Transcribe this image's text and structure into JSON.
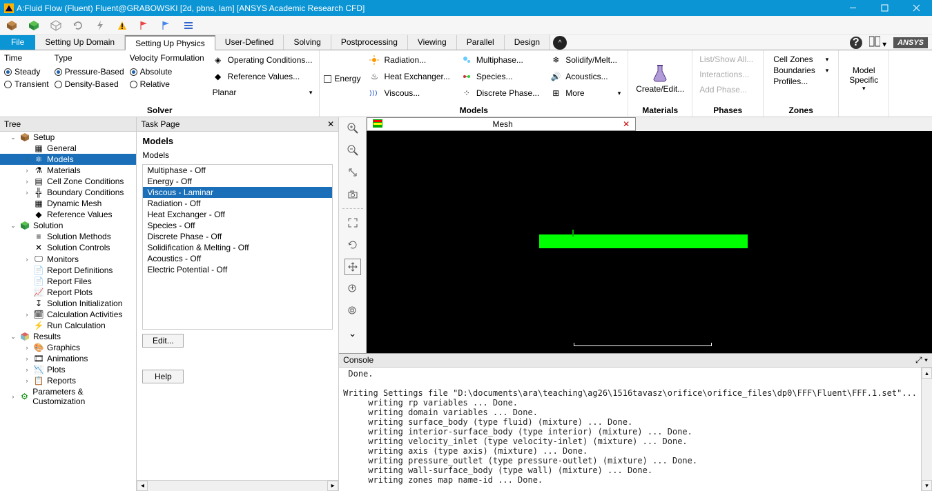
{
  "titlebar": {
    "title": "A:Fluid Flow (Fluent) Fluent@GRABOWSKI  [2d, pbns, lam]  [ANSYS Academic Research CFD]"
  },
  "tabs": {
    "file": "File",
    "domain": "Setting Up Domain",
    "physics": "Setting Up Physics",
    "user": "User-Defined",
    "solving": "Solving",
    "post": "Postprocessing",
    "viewing": "Viewing",
    "parallel": "Parallel",
    "design": "Design"
  },
  "ribbon": {
    "solver": {
      "label": "Solver",
      "time": "Time",
      "steady": "Steady",
      "transient": "Transient",
      "type": "Type",
      "pressure": "Pressure-Based",
      "density": "Density-Based",
      "vel": "Velocity Formulation",
      "abs": "Absolute",
      "rel": "Relative"
    },
    "opcond": "Operating Conditions...",
    "refval": "Reference Values...",
    "planar": "Planar",
    "energy": "Energy",
    "radiation": "Radiation...",
    "heatex": "Heat Exchanger...",
    "viscous": "Viscous...",
    "multiphase": "Multiphase...",
    "species": "Species...",
    "discrete": "Discrete Phase...",
    "solidify": "Solidify/Melt...",
    "acoustics": "Acoustics...",
    "more": "More",
    "models": "Models",
    "create": "Create/Edit...",
    "materials": "Materials",
    "list": "List/Show All...",
    "interact": "Interactions...",
    "addphase": "Add Phase...",
    "phases": "Phases",
    "cellzones": "Cell Zones",
    "boundaries": "Boundaries",
    "profiles": "Profiles...",
    "zones": "Zones",
    "modelspec": "Model\nSpecific"
  },
  "tree": {
    "header": "Tree",
    "setup": "Setup",
    "general": "General",
    "models": "Models",
    "materials": "Materials",
    "czc": "Cell Zone Conditions",
    "bc": "Boundary Conditions",
    "dynmesh": "Dynamic Mesh",
    "refval": "Reference Values",
    "solution": "Solution",
    "smeth": "Solution Methods",
    "sctrl": "Solution Controls",
    "monitors": "Monitors",
    "repdef": "Report Definitions",
    "repfiles": "Report Files",
    "repplots": "Report Plots",
    "sinit": "Solution Initialization",
    "calcact": "Calculation Activities",
    "runcalc": "Run Calculation",
    "results": "Results",
    "graphics": "Graphics",
    "anim": "Animations",
    "plots": "Plots",
    "reports": "Reports",
    "params": "Parameters & Customization"
  },
  "task": {
    "header": "Task Page",
    "title": "Models",
    "label": "Models",
    "edit": "Edit...",
    "help": "Help",
    "items": [
      "Multiphase - Off",
      "Energy - Off",
      "Viscous - Laminar",
      "Radiation - Off",
      "Heat Exchanger - Off",
      "Species - Off",
      "Discrete Phase - Off",
      "Solidification & Melting - Off",
      "Acoustics - Off",
      "Electric Potential - Off"
    ]
  },
  "viewport": {
    "tab": "Mesh"
  },
  "console": {
    "header": "Console",
    "text": " Done.\n\nWriting Settings file \"D:\\documents\\ara\\teaching\\ag26\\1516tavasz\\orifice\\orifice_files\\dp0\\FFF\\Fluent\\FFF.1.set\"...\n     writing rp variables ... Done.\n     writing domain variables ... Done.\n     writing surface_body (type fluid) (mixture) ... Done.\n     writing interior-surface_body (type interior) (mixture) ... Done.\n     writing velocity_inlet (type velocity-inlet) (mixture) ... Done.\n     writing axis (type axis) (mixture) ... Done.\n     writing pressure_outlet (type pressure-outlet) (mixture) ... Done.\n     writing wall-surface_body (type wall) (mixture) ... Done.\n     writing zones map name-id ... Done."
  },
  "brand": "ANSYS"
}
